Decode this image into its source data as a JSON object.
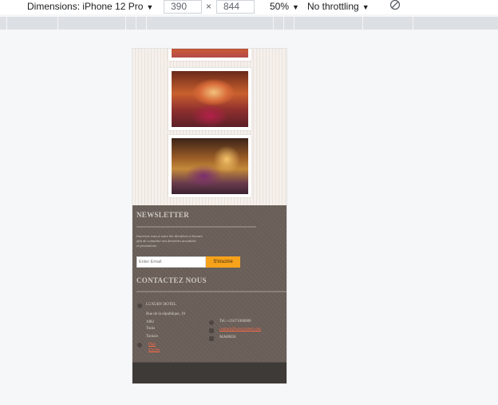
{
  "toolbar": {
    "dimensions_label": "Dimensions: iPhone 12 Pro",
    "width": "390",
    "times": "×",
    "height": "844",
    "zoom": "50%",
    "throttling": "No throttling",
    "rotate_icon": "rotate-icon"
  },
  "newsletter": {
    "title": "NEWSLETTER",
    "text_line1": "Inscrivez-vous à notre the dernières et bonnes",
    "text_line2": "afin de connaître nos dernières actualités",
    "text_line3": "et promotions.",
    "email_placeholder": "Enter Email",
    "subscribe_label": "S'inscrire"
  },
  "contact": {
    "title": "CONTACTEZ NOUS",
    "hotel_name": "LUXURY HOTEL",
    "street": "Rue de la république, 19",
    "postal": "1082",
    "city": "Tunis",
    "country": "Tunisie",
    "map_link_line1": "Plan",
    "map_link_line2": "d'accès",
    "phone": "Tél.:+21671000000",
    "email": "contact@luxuryhotel.com",
    "fax": "MA00050"
  },
  "colors": {
    "footer_bg": "#6a5f59",
    "accent_button": "#f6a21a",
    "link": "#ff6a47"
  }
}
